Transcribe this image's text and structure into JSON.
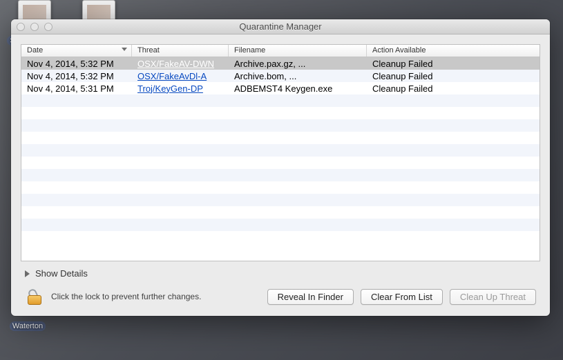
{
  "desktop": {
    "labels": {
      "waterton": "Waterton",
      "partial_s": "S"
    }
  },
  "window": {
    "title": "Quarantine Manager",
    "table": {
      "columns": {
        "date": "Date",
        "threat": "Threat",
        "filename": "Filename",
        "action": "Action Available"
      },
      "sort_column": "date",
      "rows": [
        {
          "date": "Nov 4, 2014, 5:32 PM",
          "threat": "OSX/FakeAV-DWN",
          "filename": "Archive.pax.gz, ...",
          "action": "Cleanup Failed",
          "selected": true
        },
        {
          "date": "Nov 4, 2014, 5:32 PM",
          "threat": "OSX/FakeAvDl-A",
          "filename": "Archive.bom, ...",
          "action": "Cleanup Failed",
          "selected": false
        },
        {
          "date": "Nov 4, 2014, 5:31 PM",
          "threat": "Troj/KeyGen-DP",
          "filename": "ADBEMST4 Keygen.exe",
          "action": "Cleanup Failed",
          "selected": false
        }
      ],
      "empty_stripe_count": 12
    },
    "disclosure": {
      "label": "Show Details",
      "expanded": false
    },
    "lock_message": "Click the lock to prevent further changes.",
    "buttons": {
      "reveal": "Reveal In Finder",
      "clear": "Clear From List",
      "cleanup": "Clean Up Threat",
      "cleanup_enabled": false
    }
  }
}
